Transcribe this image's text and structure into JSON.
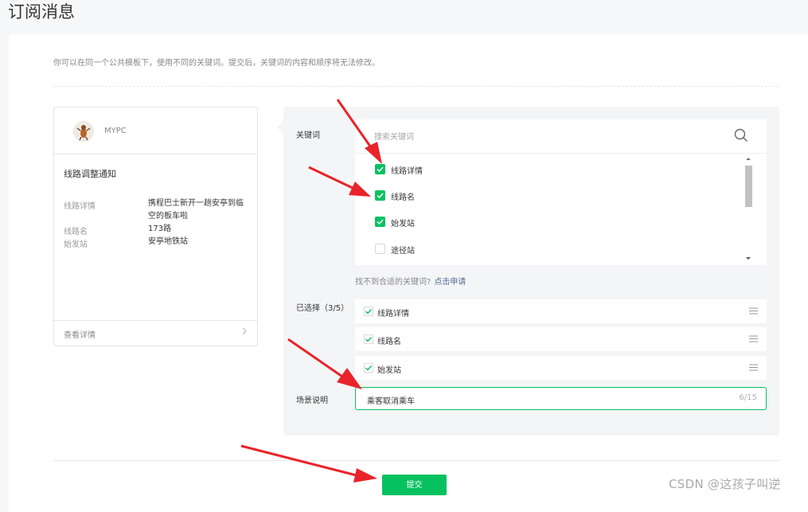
{
  "page": {
    "title": "订阅消息"
  },
  "intro": "你可以在同一个公共模板下，使用不同的关键词。提交后，关键词的内容和顺序将无法修改。",
  "preview": {
    "account_name": "MYPC",
    "message_title": "线路调整通知",
    "fields": [
      {
        "key": "线路详情",
        "value": "携程巴士新开一趟安亭到临空的板车啦"
      },
      {
        "key": "线路名",
        "value": "173路"
      },
      {
        "key": "始发站",
        "value": "安亭地铁站"
      }
    ],
    "view_details": "查看详情"
  },
  "form": {
    "keywords_label": "关键词",
    "search_placeholder": "搜索关键词",
    "keywords": [
      {
        "label": "线路详情",
        "checked": true
      },
      {
        "label": "线路名",
        "checked": true
      },
      {
        "label": "始发站",
        "checked": true
      },
      {
        "label": "途径站",
        "checked": false
      }
    ],
    "not_found_text": "找不到合适的关键词?",
    "apply_link": "点击申请",
    "selected_label": "已选择（3/5）",
    "selected": [
      "线路详情",
      "线路名",
      "始发站"
    ],
    "scene_label": "场景说明",
    "scene_value": "乘客取消乘车",
    "scene_counter": "6/15",
    "submit_label": "提交"
  },
  "colors": {
    "accent": "#07c160",
    "link": "#576b95",
    "annotation_arrow": "#e8242a"
  },
  "watermark": "CSDN @这孩子叫逆"
}
